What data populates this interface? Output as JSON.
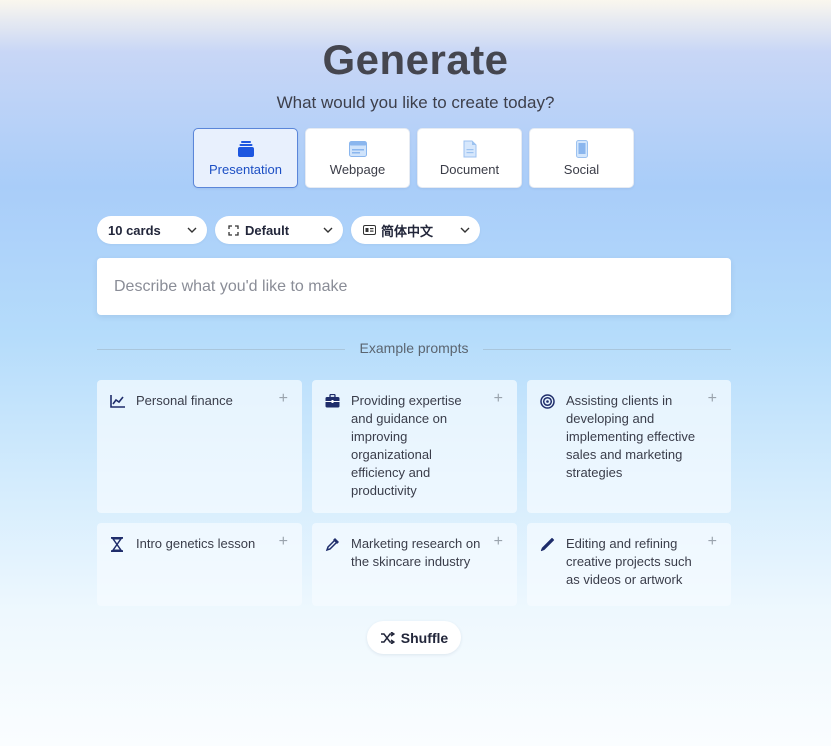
{
  "header": {
    "title": "Generate",
    "subtitle": "What would you like to create today?"
  },
  "types": [
    {
      "label": "Presentation",
      "icon": "presentation-icon",
      "active": true
    },
    {
      "label": "Webpage",
      "icon": "webpage-icon",
      "active": false
    },
    {
      "label": "Document",
      "icon": "document-icon",
      "active": false
    },
    {
      "label": "Social",
      "icon": "social-icon",
      "active": false
    }
  ],
  "options": {
    "cards": "10 cards",
    "theme": "Default",
    "language": "简体中文"
  },
  "prompt": {
    "placeholder": "Describe what you'd like to make",
    "value": ""
  },
  "examples": {
    "heading": "Example prompts",
    "items": [
      {
        "text": "Personal finance",
        "icon": "line-chart-icon"
      },
      {
        "text": "Providing expertise and guidance on improving organizational efficiency and productivity",
        "icon": "briefcase-icon"
      },
      {
        "text": "Assisting clients in developing and implementing effective sales and marketing strategies",
        "icon": "target-icon"
      },
      {
        "text": "Intro genetics lesson",
        "icon": "hourglass-icon"
      },
      {
        "text": "Marketing research on the skincare industry",
        "icon": "eyedropper-icon"
      },
      {
        "text": "Editing and refining creative projects such as videos or artwork",
        "icon": "pen-icon"
      }
    ]
  },
  "shuffle": {
    "label": "Shuffle"
  },
  "colors": {
    "accent": "#1c4fc4",
    "icon_dark": "#1f2d6b",
    "text_main": "#3a3d4a"
  }
}
